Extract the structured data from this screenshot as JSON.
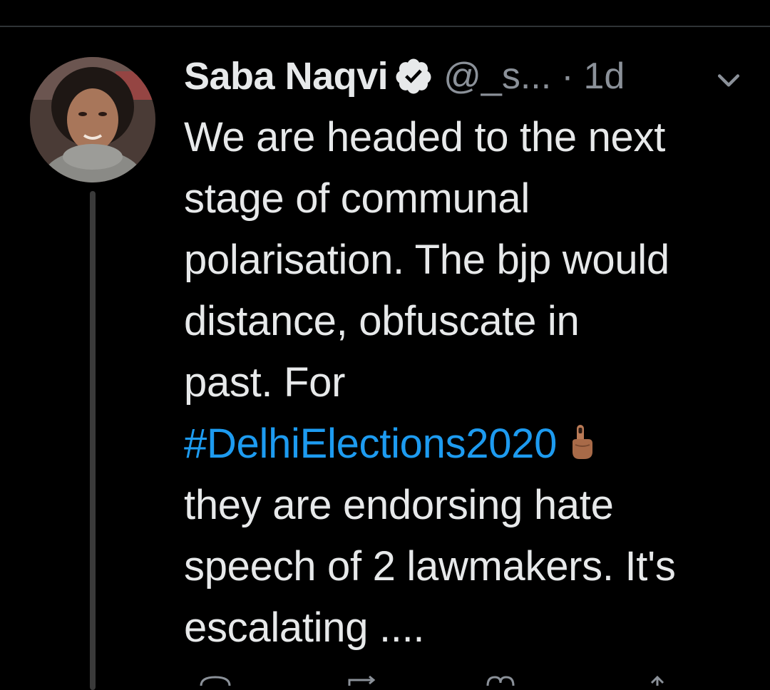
{
  "tweet": {
    "author_name": "Saba Naqvi",
    "handle": "@_s...",
    "separator": "·",
    "timestamp": "1d",
    "lines": [
      "We are headed to the next",
      "stage of communal",
      "polarisation. The bjp would",
      "distance, obfuscate in",
      "past. For"
    ],
    "hashtag": "#DelhiElections2020",
    "lines_after": [
      "they are endorsing hate",
      "speech of 2 lawmakers. It's",
      "escalating ...."
    ]
  },
  "icons": {
    "verified": "verified-badge-icon",
    "menu": "chevron-down-icon",
    "emoji": "index-pointing-up-emoji",
    "reply": "reply-icon",
    "retweet": "retweet-icon",
    "like": "like-icon",
    "share": "share-icon"
  },
  "colors": {
    "background": "#000000",
    "text": "#e7e9ea",
    "secondary_text": "#8b9199",
    "link": "#1d9bf0"
  }
}
